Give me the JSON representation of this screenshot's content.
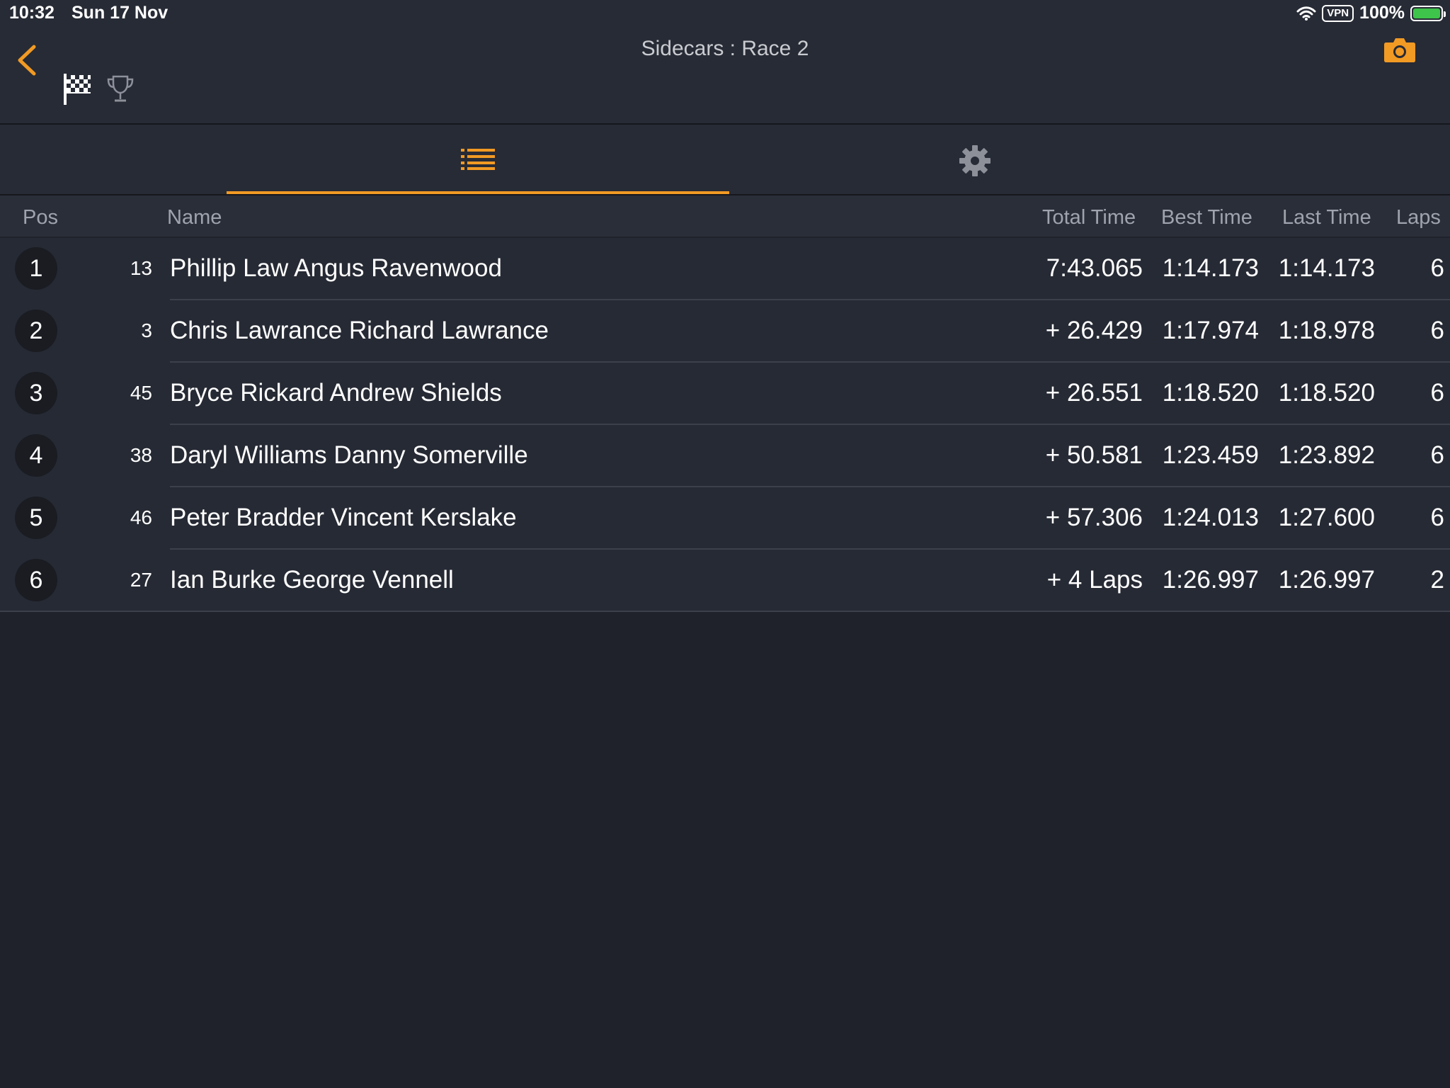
{
  "status_bar": {
    "time": "10:32",
    "date": "Sun 17 Nov",
    "vpn": "VPN",
    "battery": "100%"
  },
  "nav": {
    "title": "Sidecars : Race 2",
    "accent_color": "#f19a24",
    "icons": [
      "chevron-left-icon",
      "checkered-flag-icon",
      "trophy-icon",
      "camera-icon"
    ]
  },
  "tabs": [
    {
      "icon": "list-icon",
      "selected": true
    },
    {
      "icon": "gear-icon",
      "selected": false
    }
  ],
  "table": {
    "headers": {
      "pos": "Pos",
      "name": "Name",
      "total": "Total Time",
      "best": "Best Time",
      "last": "Last Time",
      "laps": "Laps"
    },
    "rows": [
      {
        "pos": "1",
        "num": "13",
        "name": "Phillip Law Angus Ravenwood",
        "total": "7:43.065",
        "best": "1:14.173",
        "last": "1:14.173",
        "laps": "6"
      },
      {
        "pos": "2",
        "num": "3",
        "name": "Chris Lawrance Richard Lawrance",
        "total": "+ 26.429",
        "best": "1:17.974",
        "last": "1:18.978",
        "laps": "6"
      },
      {
        "pos": "3",
        "num": "45",
        "name": "Bryce Rickard Andrew Shields",
        "total": "+ 26.551",
        "best": "1:18.520",
        "last": "1:18.520",
        "laps": "6"
      },
      {
        "pos": "4",
        "num": "38",
        "name": "Daryl Williams Danny Somerville",
        "total": "+ 50.581",
        "best": "1:23.459",
        "last": "1:23.892",
        "laps": "6"
      },
      {
        "pos": "5",
        "num": "46",
        "name": "Peter Bradder Vincent Kerslake",
        "total": "+ 57.306",
        "best": "1:24.013",
        "last": "1:27.600",
        "laps": "6"
      },
      {
        "pos": "6",
        "num": "27",
        "name": "Ian Burke George Vennell",
        "total": "+ 4 Laps",
        "best": "1:26.997",
        "last": "1:26.997",
        "laps": "2"
      }
    ]
  }
}
